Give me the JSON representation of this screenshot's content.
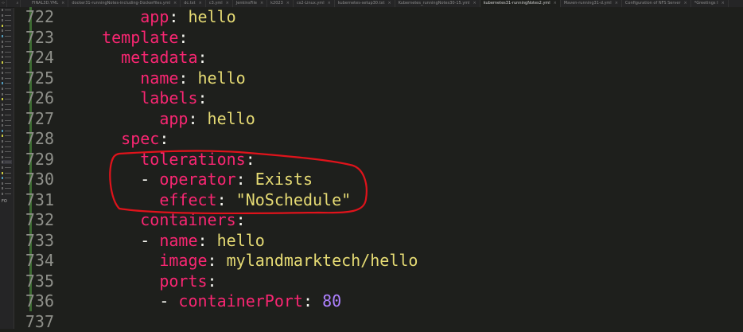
{
  "tabbar": {
    "tabs": [
      {
        "label": "FINAL3D.YML",
        "active": false
      },
      {
        "label": "docker31-runningNotes-including-Dockerfiles.yml",
        "active": false
      },
      {
        "label": "dc.txt",
        "active": false
      },
      {
        "label": "c3.yml",
        "active": false
      },
      {
        "label": "JenkinsFile",
        "active": false
      },
      {
        "label": "k2023",
        "active": false
      },
      {
        "label": "cs2-Linux.yml",
        "active": false
      },
      {
        "label": "kubernetes-setup30.txt",
        "active": false
      },
      {
        "label": "Kubernetes_runningNotes30-15.yml",
        "active": false
      },
      {
        "label": "kubernetes31-runningNotes2.yml",
        "active": true
      },
      {
        "label": "Maven-running31-d.yml",
        "active": false
      },
      {
        "label": "Configuration of NFS Server",
        "active": false
      },
      {
        "label": "*Greetings I",
        "active": false
      }
    ]
  },
  "sidebar": {
    "header": "OP",
    "section": "FO"
  },
  "editor": {
    "lines": [
      {
        "num": "722",
        "indent": "      ",
        "tokens": [
          {
            "t": "app",
            "c": "key"
          },
          {
            "t": ": ",
            "c": "plain"
          },
          {
            "t": "hello",
            "c": "val"
          }
        ]
      },
      {
        "num": "723",
        "indent": "  ",
        "tokens": [
          {
            "t": "template",
            "c": "key"
          },
          {
            "t": ":",
            "c": "plain"
          }
        ]
      },
      {
        "num": "724",
        "indent": "    ",
        "tokens": [
          {
            "t": "metadata",
            "c": "key"
          },
          {
            "t": ":",
            "c": "plain"
          }
        ]
      },
      {
        "num": "725",
        "indent": "      ",
        "tokens": [
          {
            "t": "name",
            "c": "key"
          },
          {
            "t": ": ",
            "c": "plain"
          },
          {
            "t": "hello",
            "c": "val"
          }
        ]
      },
      {
        "num": "726",
        "indent": "      ",
        "tokens": [
          {
            "t": "labels",
            "c": "key"
          },
          {
            "t": ":",
            "c": "plain"
          }
        ]
      },
      {
        "num": "727",
        "indent": "        ",
        "tokens": [
          {
            "t": "app",
            "c": "key"
          },
          {
            "t": ": ",
            "c": "plain"
          },
          {
            "t": "hello",
            "c": "val"
          }
        ]
      },
      {
        "num": "728",
        "indent": "    ",
        "tokens": [
          {
            "t": "spec",
            "c": "key"
          },
          {
            "t": ":",
            "c": "plain"
          }
        ]
      },
      {
        "num": "729",
        "indent": "      ",
        "tokens": [
          {
            "t": "tolerations",
            "c": "key"
          },
          {
            "t": ":",
            "c": "plain"
          }
        ]
      },
      {
        "num": "730",
        "indent": "      ",
        "tokens": [
          {
            "t": "- ",
            "c": "plain"
          },
          {
            "t": "operator",
            "c": "key"
          },
          {
            "t": ": ",
            "c": "plain"
          },
          {
            "t": "Exists",
            "c": "val"
          }
        ]
      },
      {
        "num": "731",
        "indent": "        ",
        "tokens": [
          {
            "t": "effect",
            "c": "key"
          },
          {
            "t": ": ",
            "c": "plain"
          },
          {
            "t": "\"NoSchedule\"",
            "c": "val"
          }
        ]
      },
      {
        "num": "732",
        "indent": "      ",
        "tokens": [
          {
            "t": "containers",
            "c": "key"
          },
          {
            "t": ":",
            "c": "plain"
          }
        ]
      },
      {
        "num": "733",
        "indent": "      ",
        "tokens": [
          {
            "t": "- ",
            "c": "plain"
          },
          {
            "t": "name",
            "c": "key"
          },
          {
            "t": ": ",
            "c": "plain"
          },
          {
            "t": "hello",
            "c": "val"
          }
        ]
      },
      {
        "num": "734",
        "indent": "        ",
        "tokens": [
          {
            "t": "image",
            "c": "key"
          },
          {
            "t": ": ",
            "c": "plain"
          },
          {
            "t": "mylandmarktech/hello",
            "c": "val"
          }
        ]
      },
      {
        "num": "735",
        "indent": "        ",
        "tokens": [
          {
            "t": "ports",
            "c": "key"
          },
          {
            "t": ":",
            "c": "plain"
          }
        ]
      },
      {
        "num": "736",
        "indent": "        ",
        "tokens": [
          {
            "t": "- ",
            "c": "plain"
          },
          {
            "t": "containerPort",
            "c": "key"
          },
          {
            "t": ": ",
            "c": "plain"
          },
          {
            "t": "80",
            "c": "num"
          }
        ]
      },
      {
        "num": "737",
        "indent": "",
        "tokens": []
      }
    ]
  },
  "colors": {
    "background": "#1e1f1c",
    "key": "#f92672",
    "value": "#e6db74",
    "number": "#ae81ff",
    "annotation": "#e0131b"
  }
}
